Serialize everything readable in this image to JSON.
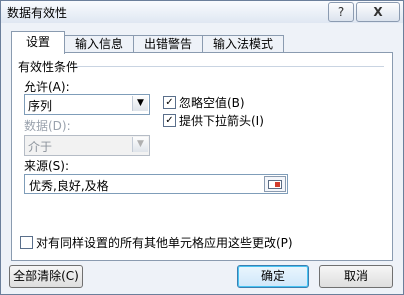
{
  "dialog": {
    "title": "数据有效性",
    "help_label": "?",
    "close_label": "X"
  },
  "tabs": [
    {
      "label": "设置"
    },
    {
      "label": "输入信息"
    },
    {
      "label": "出错警告"
    },
    {
      "label": "输入法模式"
    }
  ],
  "settings": {
    "section_title": "有效性条件",
    "allow_label": "允许(A):",
    "allow_value": "序列",
    "data_label": "数据(D):",
    "data_value": "介于",
    "ignore_blank_label": "忽略空值(B)",
    "ignore_blank_checked": true,
    "dropdown_label": "提供下拉箭头(I)",
    "dropdown_checked": true,
    "source_label": "来源(S):",
    "source_value": "优秀,良好,及格",
    "apply_all_label": "对有同样设置的所有其他单元格应用这些更改(P)",
    "apply_all_checked": false
  },
  "buttons": {
    "clear_all": "全部清除(C)",
    "ok": "确定",
    "cancel": "取消"
  }
}
